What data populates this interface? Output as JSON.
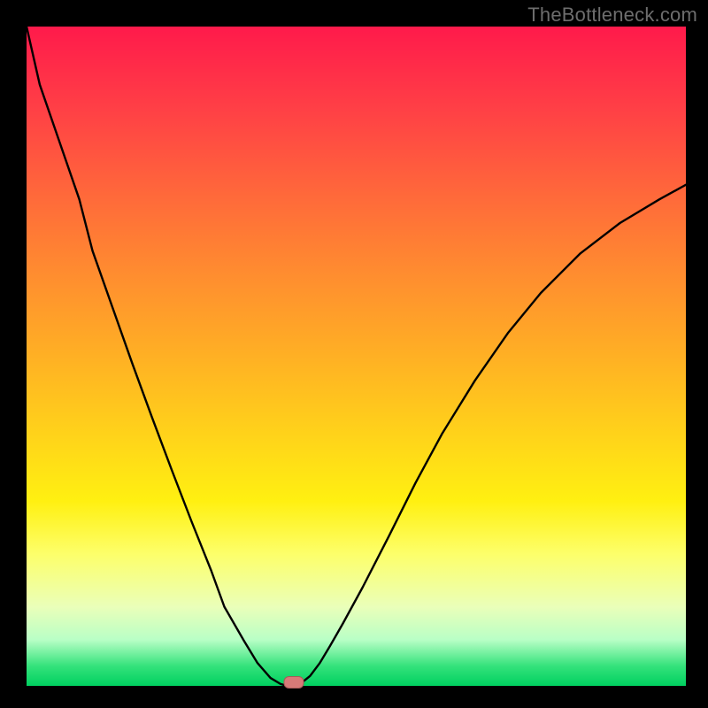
{
  "watermark": "TheBottleneck.com",
  "chart_data": {
    "type": "line",
    "title": "",
    "xlabel": "",
    "ylabel": "",
    "x": [
      0.0,
      0.02,
      0.05,
      0.08,
      0.1,
      0.13,
      0.16,
      0.19,
      0.22,
      0.25,
      0.28,
      0.3,
      0.33,
      0.35,
      0.37,
      0.385,
      0.395,
      0.4,
      0.405,
      0.415,
      0.43,
      0.445,
      0.46,
      0.48,
      0.51,
      0.55,
      0.59,
      0.63,
      0.68,
      0.73,
      0.78,
      0.84,
      0.9,
      0.96,
      1.0
    ],
    "y": [
      1.0,
      0.912,
      0.825,
      0.738,
      0.66,
      0.575,
      0.49,
      0.408,
      0.328,
      0.25,
      0.175,
      0.12,
      0.068,
      0.035,
      0.012,
      0.003,
      0.0,
      0.0,
      0.0,
      0.003,
      0.015,
      0.035,
      0.06,
      0.095,
      0.15,
      0.228,
      0.308,
      0.382,
      0.463,
      0.535,
      0.596,
      0.656,
      0.702,
      0.738,
      0.76
    ],
    "xlim": [
      0,
      1
    ],
    "ylim": [
      0,
      1
    ],
    "grid": false,
    "marker": {
      "x": 0.405,
      "y": 0.005
    }
  }
}
